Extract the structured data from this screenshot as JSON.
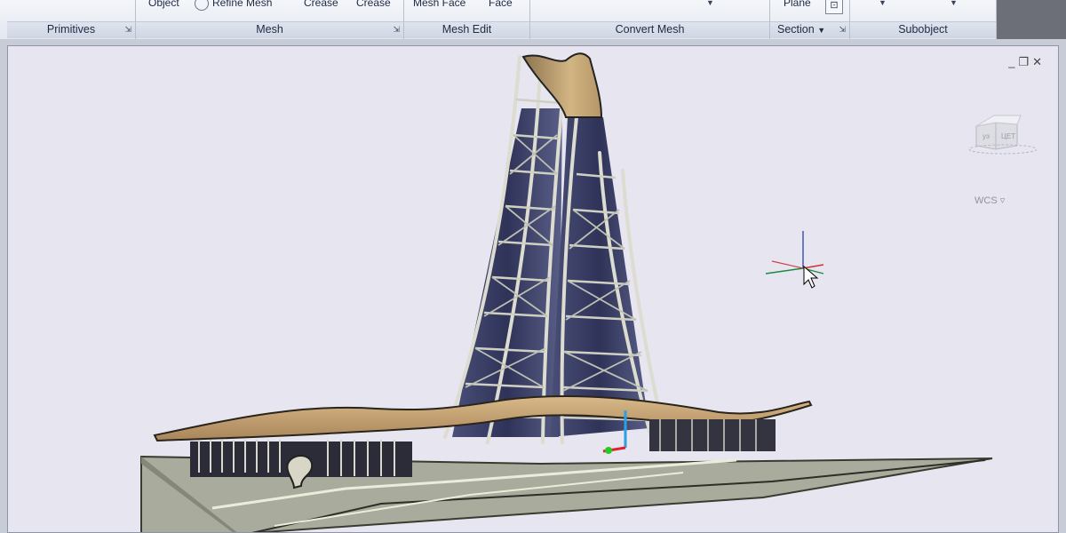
{
  "ribbon": {
    "panels": [
      {
        "title": "Primitives"
      },
      {
        "title": "Mesh",
        "buttons": {
          "object": "Object",
          "refine": "Refine Mesh",
          "crease": "Crease",
          "uncrease": "Crease"
        }
      },
      {
        "title": "Mesh Edit",
        "buttons": {
          "mesh_face": "Mesh Face",
          "face": "Face"
        }
      },
      {
        "title": "Convert Mesh"
      },
      {
        "title": "Section",
        "buttons": {
          "plane": "Plane"
        }
      },
      {
        "title": "Subobject"
      }
    ]
  },
  "viewport": {
    "controls": [
      "_",
      "❐",
      "✕"
    ],
    "viewcube": {
      "left_label": "уэ",
      "right_label": "ЦЕТ"
    },
    "wcs_label": "WCS",
    "background_color": "#e6e5f0",
    "model_color_roof": "#c9a572",
    "model_color_frame": "#d6d7ce",
    "model_color_glass": "#3d4266"
  }
}
